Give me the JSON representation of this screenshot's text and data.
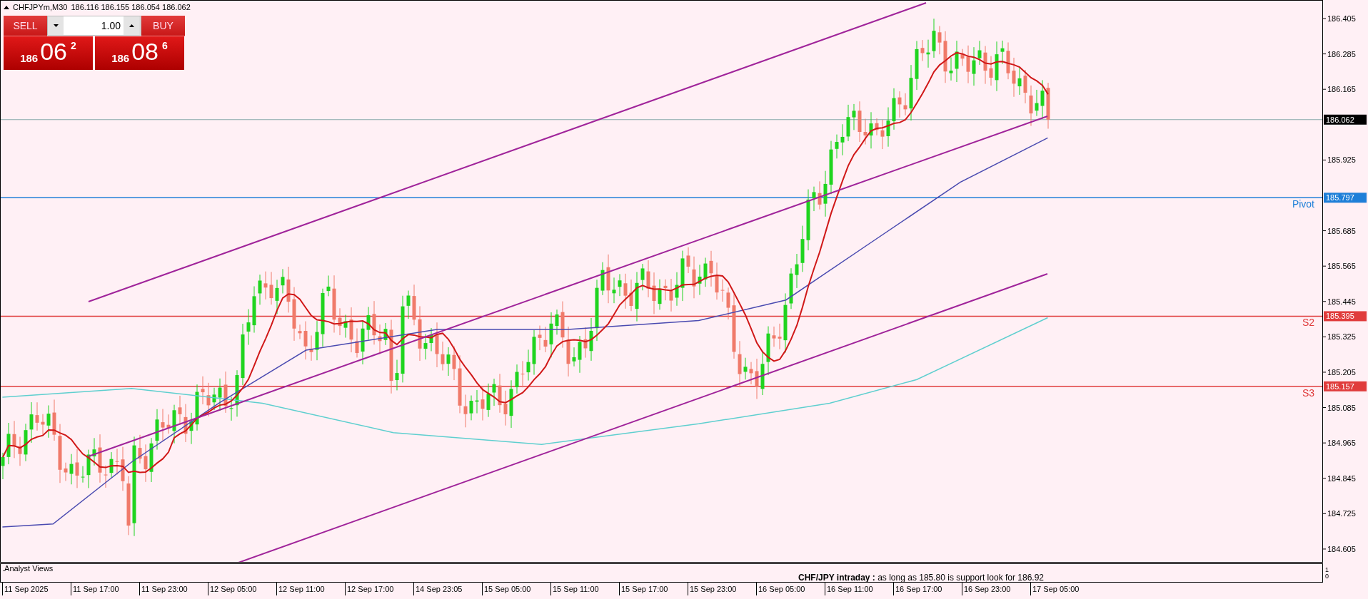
{
  "chart": {
    "symbol": "CHFJPYm,M30",
    "ohlc": "186.116 186.155 186.054 186.062"
  },
  "trade_panel": {
    "sell_label": "SELL",
    "buy_label": "BUY",
    "volume": "1.00",
    "sell_price": {
      "prefix": "186",
      "pips": "06",
      "fraction": "2"
    },
    "buy_price": {
      "prefix": "186",
      "pips": "08",
      "fraction": "6"
    }
  },
  "price_axis": {
    "ticks": [
      "186.405",
      "186.285",
      "186.165",
      "185.925",
      "185.685",
      "185.565",
      "185.445",
      "185.325",
      "185.205",
      "185.085",
      "184.965",
      "184.845",
      "184.725",
      "184.605"
    ],
    "current_price": "186.062"
  },
  "levels": [
    {
      "name": "Pivot",
      "price": "185.797",
      "color": "#1e7fd8"
    },
    {
      "name": "S2",
      "price": "185.395",
      "color": "#e03c3c"
    },
    {
      "name": "S3",
      "price": "185.157",
      "color": "#e03c3c"
    }
  ],
  "indicator": {
    "name": ".Analyst Views",
    "comment": "**CHF/JPY intraday :**   as long as 185.80 is support look for 186.92",
    "scale": [
      "1",
      "0"
    ]
  },
  "time_axis": [
    "11 Sep 2025",
    "11 Sep 17:00",
    "11 Sep 23:00",
    "12 Sep 05:00",
    "12 Sep 11:00",
    "12 Sep 17:00",
    "14 Sep 23:05",
    "15 Sep 05:00",
    "15 Sep 11:00",
    "15 Sep 17:00",
    "15 Sep 23:00",
    "16 Sep 05:00",
    "16 Sep 11:00",
    "16 Sep 17:00",
    "16 Sep 23:00",
    "17 Sep 05:00"
  ]
}
